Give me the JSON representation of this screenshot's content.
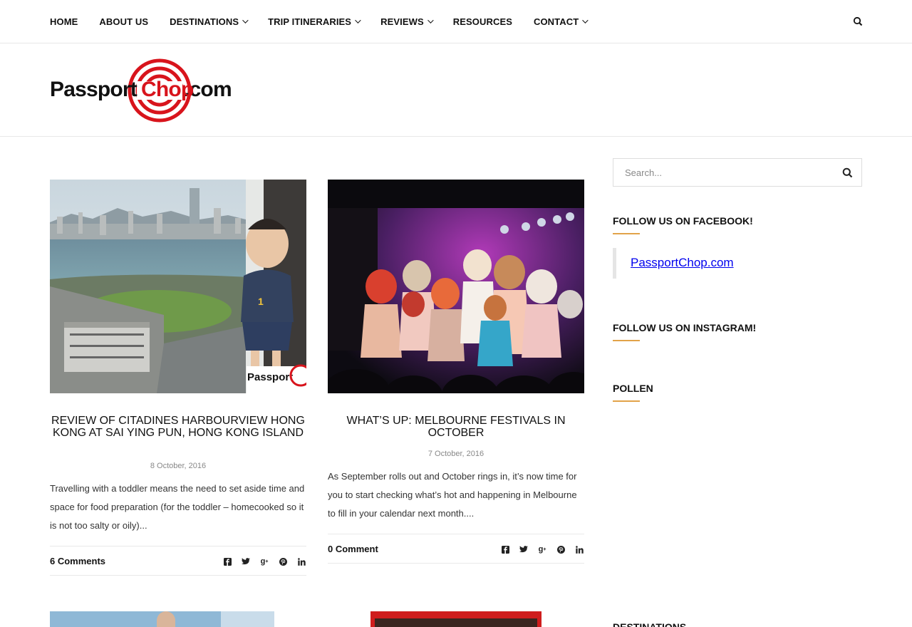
{
  "nav": {
    "items": [
      {
        "label": "HOME",
        "dropdown": false
      },
      {
        "label": "ABOUT US",
        "dropdown": false
      },
      {
        "label": "DESTINATIONS",
        "dropdown": true
      },
      {
        "label": "TRIP ITINERARIES",
        "dropdown": true
      },
      {
        "label": "REVIEWS",
        "dropdown": true
      },
      {
        "label": "RESOURCES",
        "dropdown": false
      },
      {
        "label": "CONTACT",
        "dropdown": true
      }
    ],
    "search_icon": "search-icon"
  },
  "logo": {
    "pre": "Passport",
    "brand": "Chop",
    "post": ".com",
    "brand_color": "#d8141c"
  },
  "posts": [
    {
      "title": "REVIEW OF CITADINES HARBOURVIEW HONG KONG AT SAI YING PUN, HONG KONG ISLAND",
      "date": "8 October, 2016",
      "excerpt": "Travelling with a toddler means the need to set aside time and space for food preparation (for the toddler – homecooked so it is not too salty or oily)...",
      "comments": "6 Comments",
      "image": "hong-kong-harbour-toddler-photo",
      "watermark": "Passport"
    },
    {
      "title": "WHAT’S UP: MELBOURNE FESTIVALS IN OCTOBER",
      "date": "7 October, 2016",
      "excerpt": "As September rolls out and October rings in, it’s now time for you to start checking what’s hot and happening in Melbourne to fill in your calendar next month....",
      "comments": "0 Comment",
      "image": "stage-performers-photo"
    }
  ],
  "share_icons": [
    "facebook-icon",
    "twitter-icon",
    "google-plus-icon",
    "pinterest-icon",
    "linkedin-icon"
  ],
  "sidebar": {
    "search_placeholder": "Search...",
    "facebook_title": "FOLLOW US ON FACEBOOK!",
    "facebook_link": "PassportChop.com",
    "instagram_title": "FOLLOW US ON INSTAGRAM!",
    "pollen_title": "POLLEN",
    "destinations_title": "DESTINATIONS",
    "accent_color": "#e2a349"
  }
}
